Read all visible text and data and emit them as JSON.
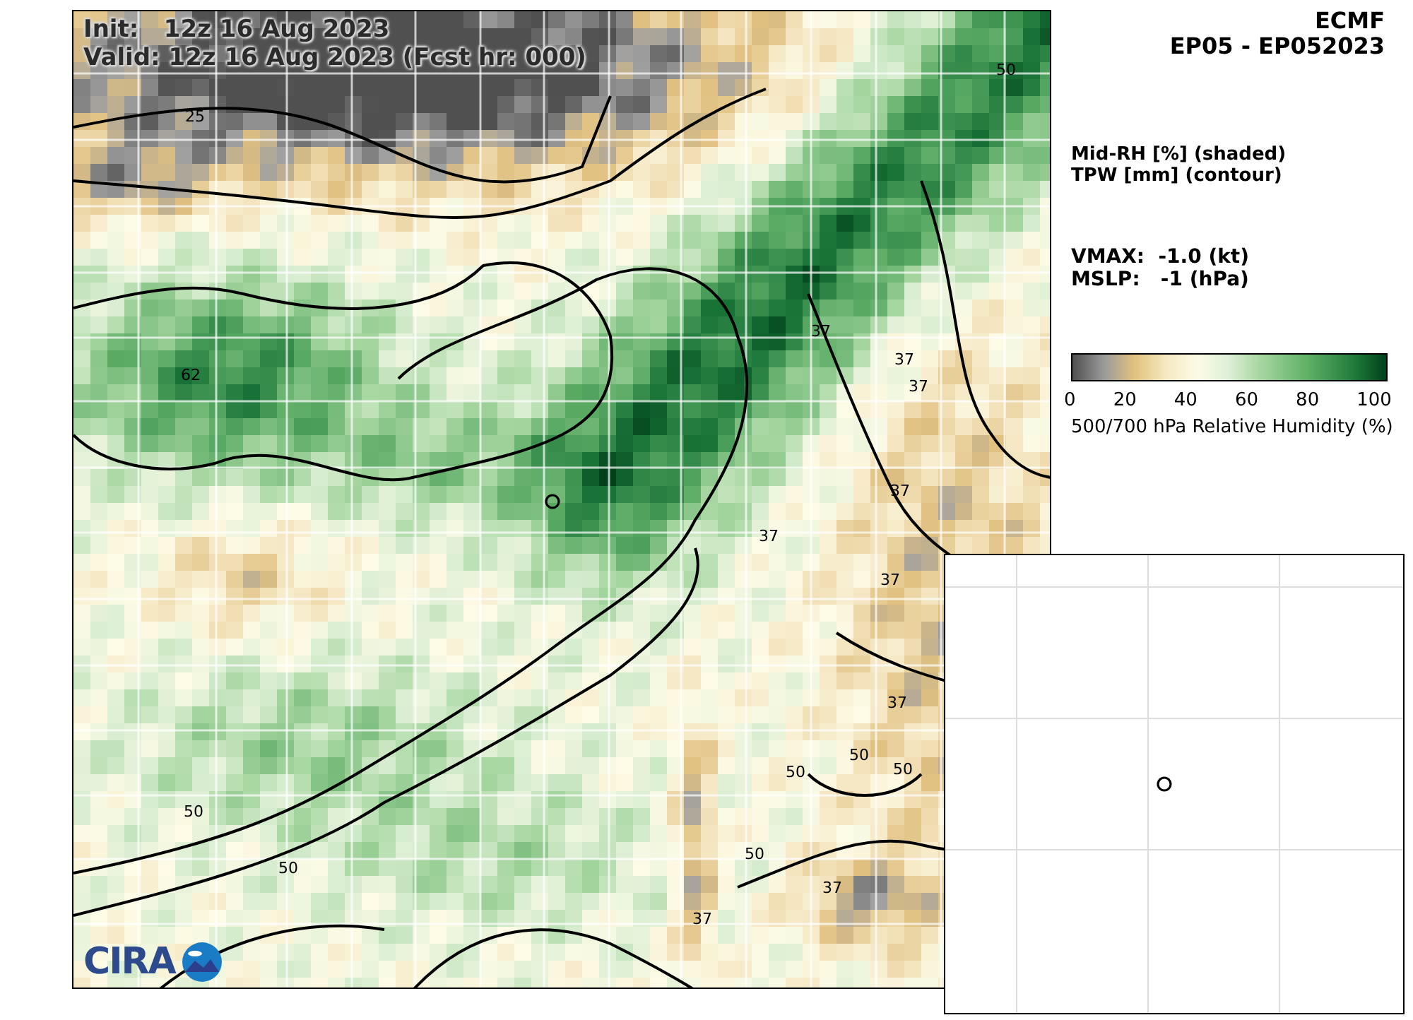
{
  "map": {
    "init_line": "Init:   12z 16 Aug 2023",
    "valid_line": "Valid: 12z 16 Aug 2023 (Fcst hr: 000)",
    "contour_labels": [
      "25",
      "50",
      "62",
      "37",
      "37",
      "37",
      "37",
      "37",
      "37",
      "37",
      "50",
      "50",
      "50",
      "50",
      "50",
      "50",
      "37",
      "37"
    ],
    "logo_text": "CIRA"
  },
  "header": {
    "model": "ECMF",
    "storm": "EP05 - EP052023"
  },
  "legend": {
    "lines": [
      "Mid-RH [%] (shaded)",
      "TPW [mm] (contour)"
    ]
  },
  "intensity": {
    "lines": [
      "VMAX:  -1.0 (kt)",
      "MSLP:   -1 (hPa)"
    ]
  },
  "colorbar": {
    "ticks": [
      "0",
      "20",
      "40",
      "60",
      "80",
      "100"
    ],
    "label": "500/700 hPa Relative Humidity (%)"
  }
}
